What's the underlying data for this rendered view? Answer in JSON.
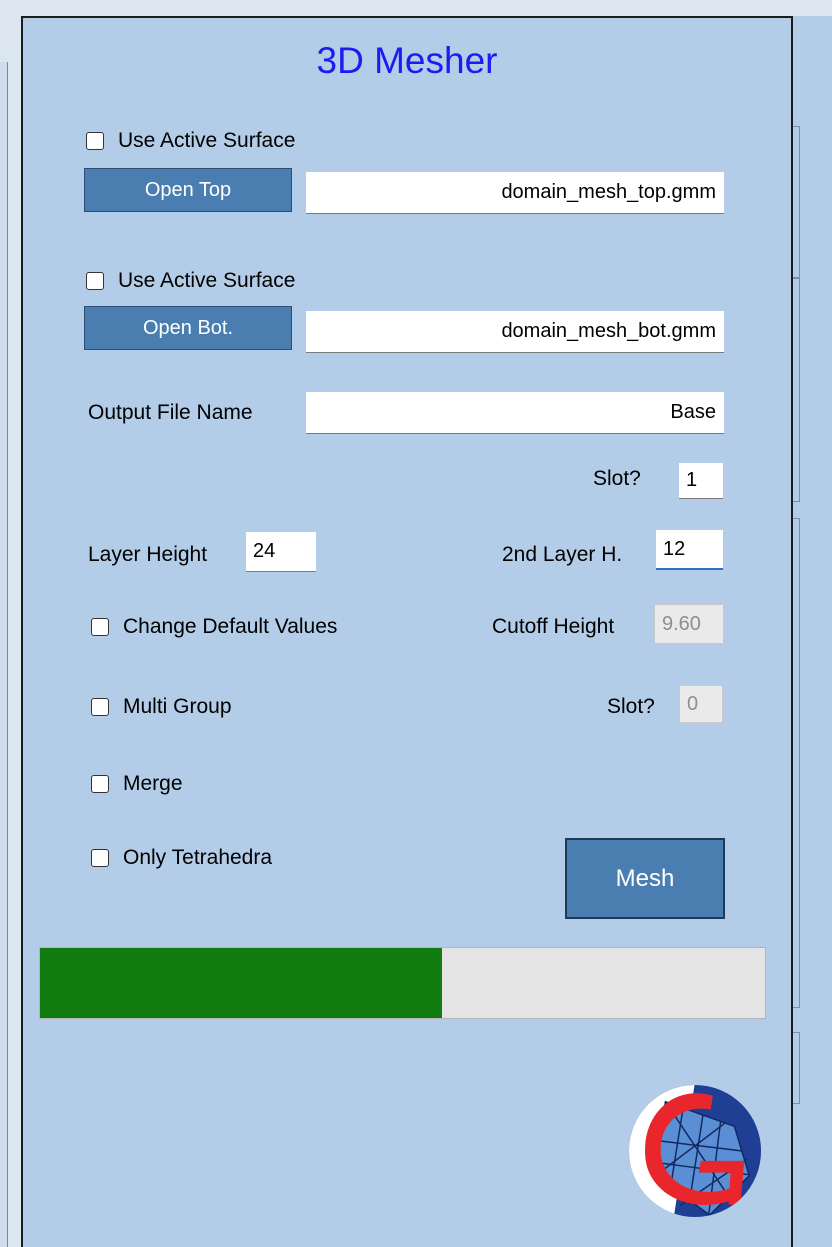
{
  "title": "3D Mesher",
  "top": {
    "use_active_label": "Use Active Surface",
    "open_label": "Open Top",
    "file": "domain_mesh_top.gmm"
  },
  "bot": {
    "use_active_label": "Use Active Surface",
    "open_label": "Open Bot.",
    "file": "domain_mesh_bot.gmm"
  },
  "output": {
    "label": "Output File Name",
    "value": "Base",
    "slot_label": "Slot?",
    "slot_value": "1"
  },
  "layer": {
    "height_label": "Layer Height",
    "height_value": "24",
    "second_label": "2nd Layer H.",
    "second_value": "12"
  },
  "options": {
    "change_defaults": "Change Default Values",
    "cutoff_label": "Cutoff Height",
    "cutoff_value": "9.60",
    "multi_group": "Multi Group",
    "slot_label": "Slot?",
    "slot_value": "0",
    "merge": "Merge",
    "only_tetra": "Only Tetrahedra"
  },
  "mesh_button": "Mesh",
  "progress": {
    "fraction": 0.555
  },
  "colors": {
    "panel": "#b3cde8",
    "button": "#4a7db0",
    "title": "#1b1bf2",
    "progress_fill": "#107c10"
  },
  "logo_icon": "gmesh-logo-icon"
}
